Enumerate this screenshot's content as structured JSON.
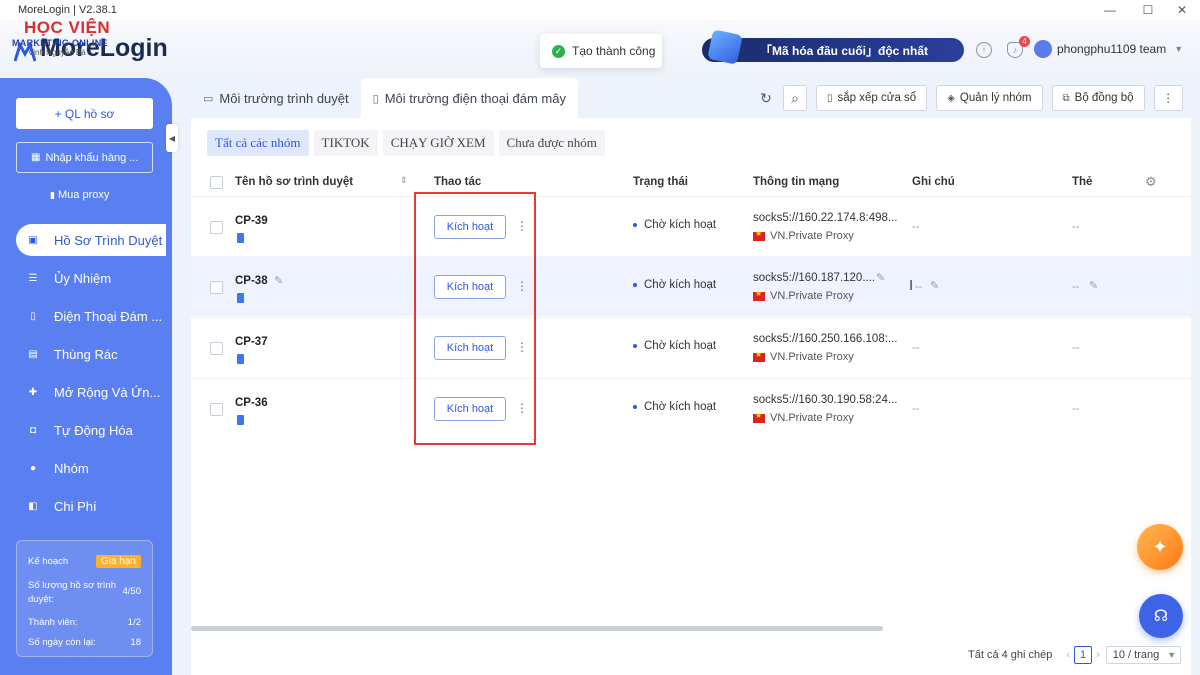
{
  "window": {
    "title": "MoreLogin | V2.38.1"
  },
  "logo": {
    "brand": "MoreLogin",
    "overlay_line1": "HỌC VIỆN",
    "overlay_line2": "MARKETING ONLINE",
    "overlay_line3": "Vinh Nguyễn Bá"
  },
  "toast": {
    "text": "Tạo thành công"
  },
  "header": {
    "banner_text": "「Mã hóa đầu cuối」độc nhất",
    "notification_count": "4",
    "user_name": "phongphu1109 team"
  },
  "sidebar": {
    "new_profile": "+ QL hồ sơ",
    "import_label": "Nhập khẩu hàng ...",
    "buy_proxy": "Mua proxy",
    "items": [
      {
        "label": "Hồ Sơ Trình Duyệt",
        "icon": "browser-icon",
        "active": true
      },
      {
        "label": "Ủy Nhiệm",
        "icon": "list-icon"
      },
      {
        "label": "Điện Thoại Đám ...",
        "icon": "phone-icon"
      },
      {
        "label": "Thùng Rác",
        "icon": "trash-icon"
      },
      {
        "label": "Mở Rộng Và Ứn...",
        "icon": "puzzle-icon"
      },
      {
        "label": "Tự Động Hóa",
        "icon": "robot-icon"
      },
      {
        "label": "Nhóm",
        "icon": "group-icon"
      },
      {
        "label": "Chi Phí",
        "icon": "wallet-icon"
      }
    ],
    "plan": {
      "label": "Kế hoạch",
      "upgrade": "Gia hạn",
      "profiles_label": "Số lượng hồ sơ trình duyệt:",
      "profiles_value": "4/50",
      "members_label": "Thành viên:",
      "members_value": "1/2",
      "days_label": "Số ngày còn lại:",
      "days_value": "18"
    }
  },
  "tabs": [
    {
      "label": "Môi trường trình duyệt",
      "active": true
    },
    {
      "label": "Môi trường điện thoại đám mây",
      "active": false
    }
  ],
  "toolbar": {
    "arrange": "sắp xếp cửa sổ",
    "groups": "Quản lý nhóm",
    "sync": "Bộ đồng bộ"
  },
  "filters": [
    "Tất cả các nhóm",
    "TIKTOK",
    "CHẠY GIỜ XEM",
    "Chưa được nhóm"
  ],
  "table": {
    "headers": {
      "name": "Tên hồ sơ trình duyệt",
      "action": "Thao tác",
      "status": "Trạng thái",
      "network": "Thông tin mạng",
      "note": "Ghi chú",
      "tag": "Thẻ"
    },
    "rows": [
      {
        "name": "CP-39",
        "action": "Kích hoạt",
        "status": "Chờ kích hoạt",
        "proxy": "socks5://160.22.174.8:498...",
        "proxy_name": "VN.Private Proxy",
        "note": "--",
        "tag": "--"
      },
      {
        "name": "CP-38",
        "action": "Kích hoạt",
        "status": "Chờ kích hoạt",
        "proxy": "socks5://160.187.120....",
        "proxy_name": "VN.Private Proxy",
        "note": "--",
        "tag": "--"
      },
      {
        "name": "CP-37",
        "action": "Kích hoạt",
        "status": "Chờ kích hoạt",
        "proxy": "socks5://160.250.166.108:...",
        "proxy_name": "VN.Private Proxy",
        "note": "--",
        "tag": "--"
      },
      {
        "name": "CP-36",
        "action": "Kích hoạt",
        "status": "Chờ kích hoạt",
        "proxy": "socks5://160.30.190.58:24...",
        "proxy_name": "VN.Private Proxy",
        "note": "--",
        "tag": "--"
      }
    ]
  },
  "footer": {
    "total": "Tất cả 4 ghi chép",
    "page": "1",
    "page_size": "10 / trang"
  }
}
